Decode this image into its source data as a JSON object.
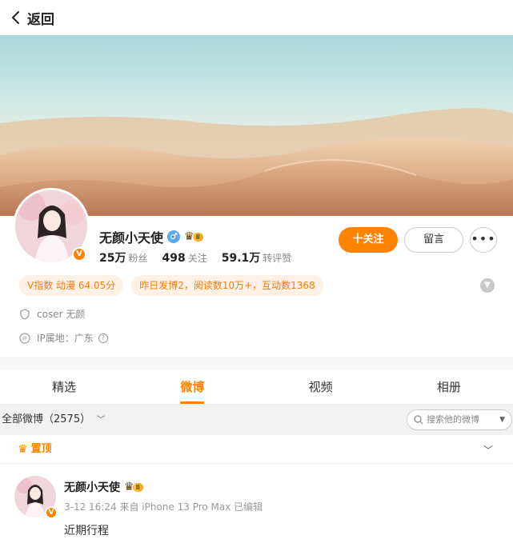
{
  "header": {
    "back_label": "返回"
  },
  "profile": {
    "name": "无颜小天使",
    "gender_symbol": "♂",
    "vip_level": "Ⅱ",
    "verified_badge": "V",
    "stats": [
      {
        "value": "25万",
        "label": "粉丝"
      },
      {
        "value": "498",
        "label": "关注"
      },
      {
        "value": "59.1万",
        "label": "转评赞"
      }
    ],
    "follow_label": "十关注",
    "message_label": "留言",
    "more_label": "•••",
    "tags": [
      "V指数 动漫 64.05分",
      "昨日发博2，阅读数10万+，互动数1368"
    ],
    "description": "coser 无颜",
    "ip_location": "IP属地：广东",
    "help_symbol": "?"
  },
  "tabs": [
    {
      "label": "精选",
      "active": false
    },
    {
      "label": "微博",
      "active": true
    },
    {
      "label": "视频",
      "active": false
    },
    {
      "label": "相册",
      "active": false
    }
  ],
  "filter": {
    "label": "全部微博（2575）",
    "search_placeholder": "搜索他的微博"
  },
  "pinned": {
    "label": "置顶"
  },
  "post": {
    "author": "无颜小天使",
    "vip_level": "Ⅱ",
    "meta": "3-12 16:24 来自 iPhone 13 Pro Max 已编辑",
    "text": "近期行程"
  },
  "colors": {
    "accent": "#ff8200",
    "tag_bg": "#fff1e6",
    "gender": "#5aa8e6"
  }
}
